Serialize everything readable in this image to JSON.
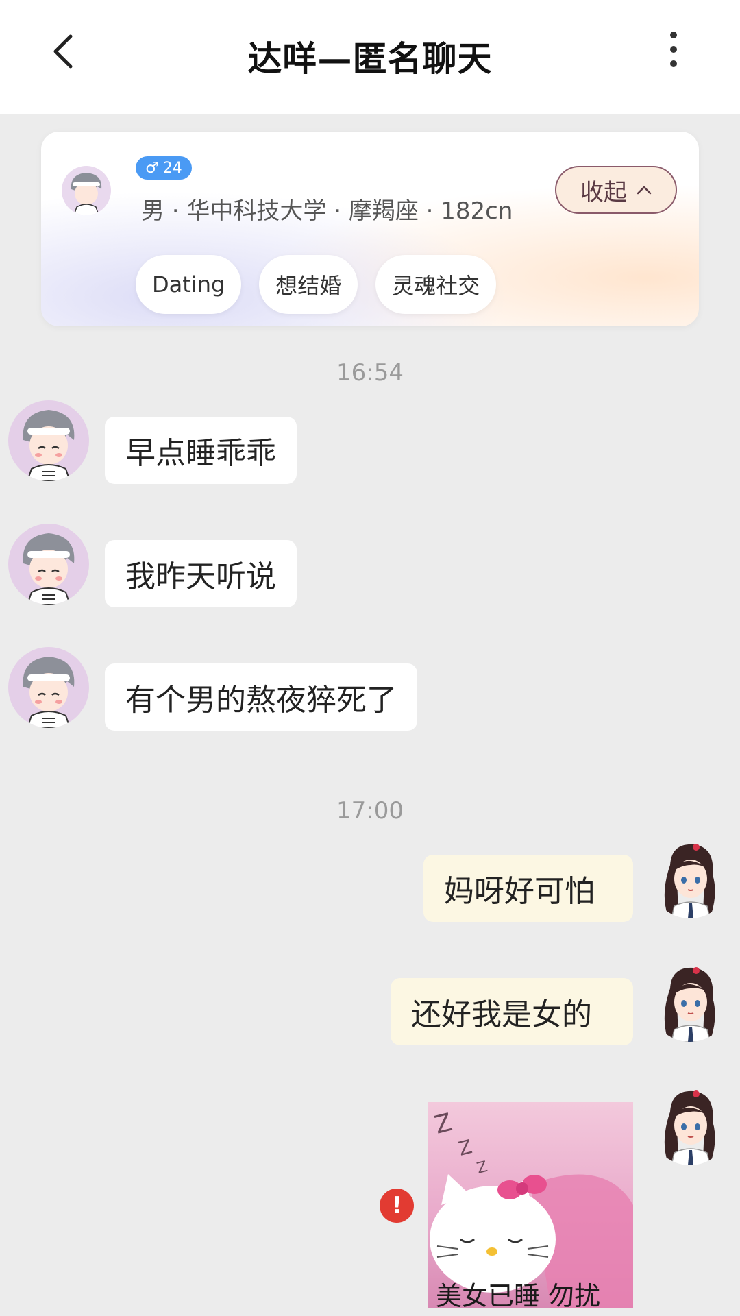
{
  "header": {
    "title": "达咩—匿名聊天"
  },
  "profile_card": {
    "age": "24",
    "info": "男 · 华中科技大学 · 摩羯座 · 182cn",
    "collapse_label": "收起",
    "tags": [
      "Dating",
      "想结婚",
      "灵魂社交"
    ]
  },
  "timestamps": [
    "16:54",
    "17:00"
  ],
  "messages": [
    {
      "side": "in",
      "text": "早点睡乖乖"
    },
    {
      "side": "in",
      "text": "我昨天听说"
    },
    {
      "side": "in",
      "text": "有个男的熬夜猝死了"
    },
    {
      "side": "out",
      "text": "妈呀好可怕"
    },
    {
      "side": "out",
      "text": "还好我是女的"
    },
    {
      "side": "out",
      "type": "sticker",
      "caption": "美女已睡 勿扰",
      "status": "failed"
    }
  ],
  "colors": {
    "accent_blue": "#4a9af4",
    "error_red": "#e23b32",
    "outgoing_bubble": "#fcf7e3",
    "incoming_bubble": "#ffffff"
  }
}
